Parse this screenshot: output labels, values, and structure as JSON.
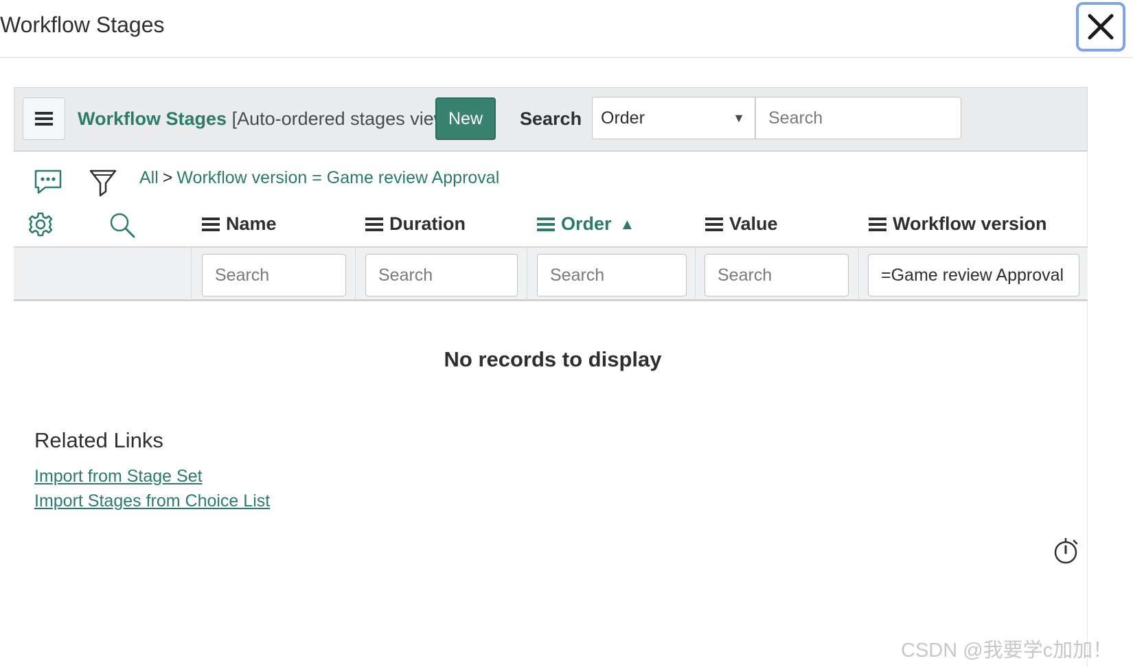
{
  "dialog": {
    "title": "Workflow Stages"
  },
  "toolbar": {
    "list_name": "Workflow Stages",
    "view_label": "[Auto-ordered stages view]",
    "new_label": "New",
    "search_label": "Search",
    "field_select_value": "Order",
    "search_placeholder": "Search"
  },
  "breadcrumb": {
    "all": "All",
    "separator": ">",
    "filter": "Workflow version = Game review Approval"
  },
  "columns": [
    {
      "label": "Name"
    },
    {
      "label": "Duration"
    },
    {
      "label": "Order",
      "sort": "ascending"
    },
    {
      "label": "Value"
    },
    {
      "label": "Workflow version"
    }
  ],
  "sort_indicator": "▲",
  "filters": {
    "name_placeholder": "Search",
    "duration_placeholder": "Search",
    "order_placeholder": "Search",
    "value_placeholder": "Search",
    "workflow_version_value": "=Game review Approval"
  },
  "empty_message": "No records to display",
  "related_links": {
    "title": "Related Links",
    "links": [
      {
        "label": "Import from Stage Set"
      },
      {
        "label": "Import Stages from Choice List"
      }
    ]
  },
  "watermark": "CSDN @我要学c加加！",
  "colors": {
    "accent": "#2c7a6a",
    "button": "#3a8270",
    "toolbar_bg": "#e9ebed"
  }
}
